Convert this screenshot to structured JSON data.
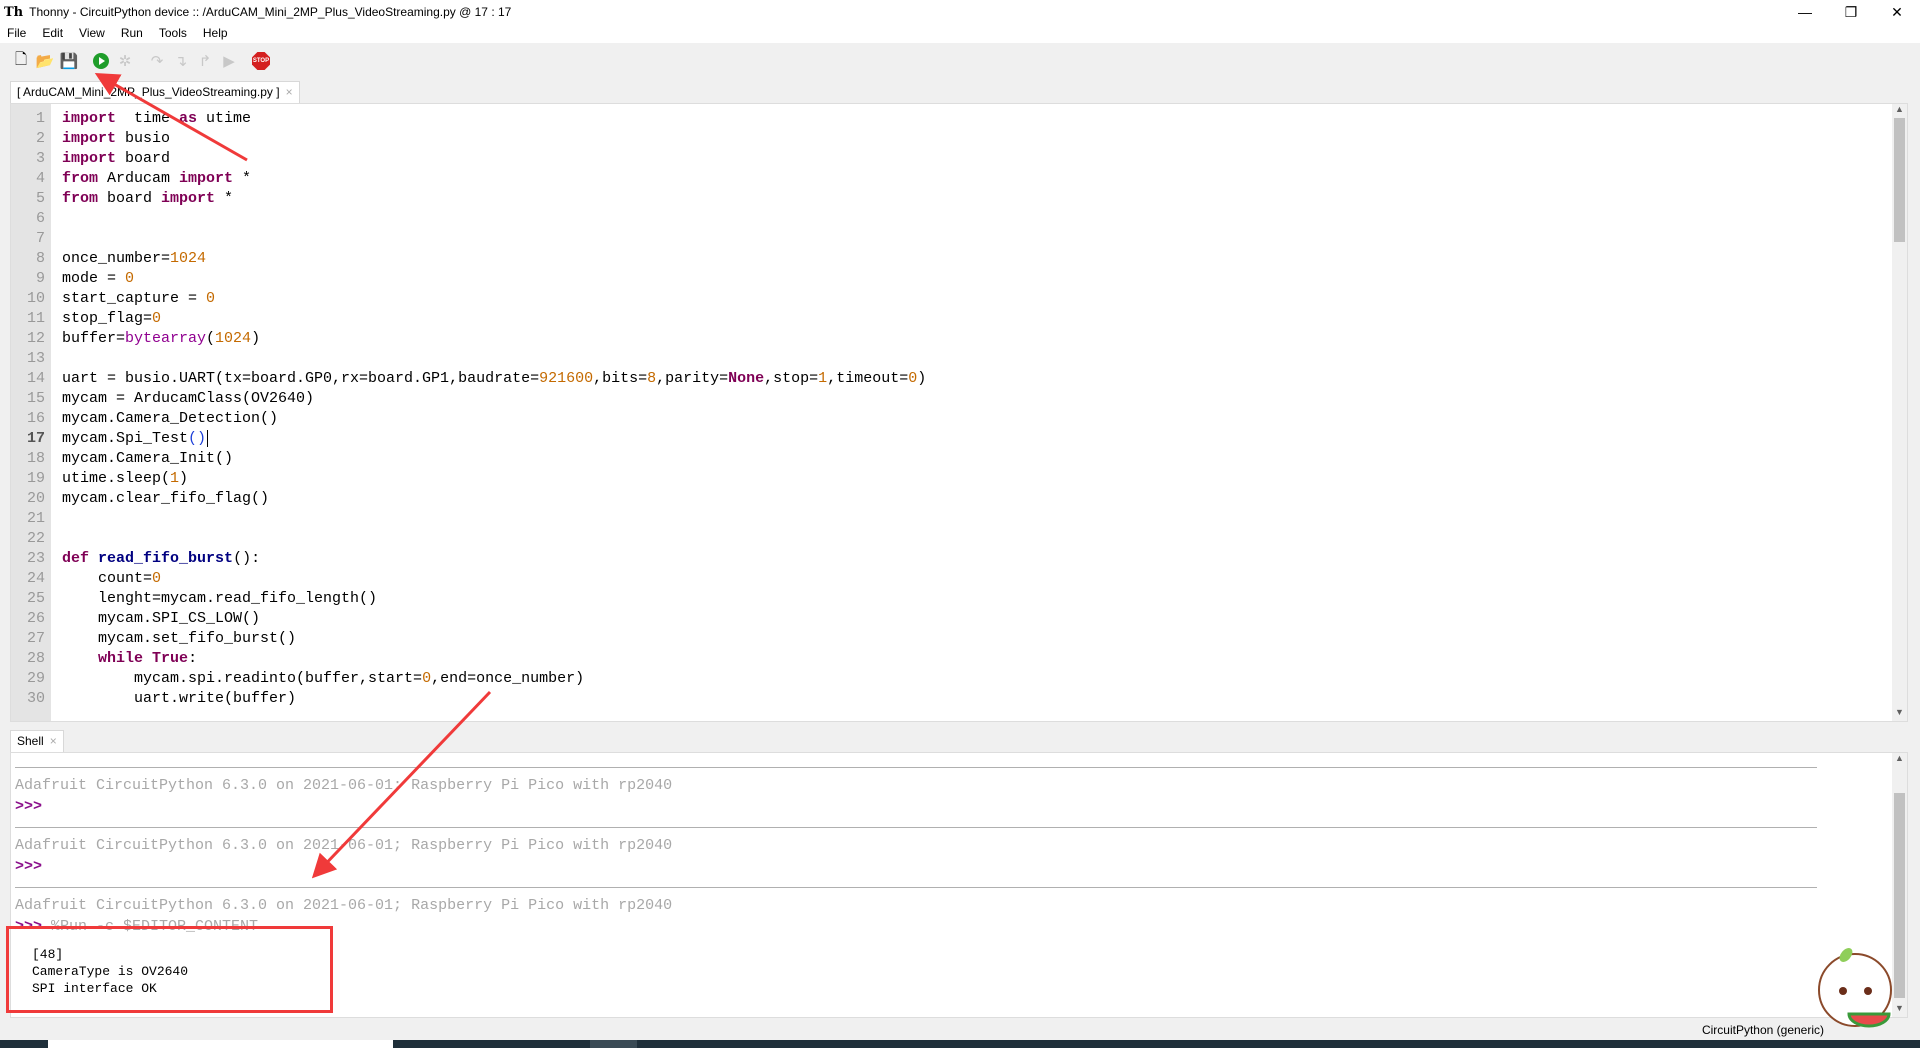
{
  "window": {
    "title": "Thonny  -  CircuitPython device :: /ArduCAM_Mini_2MP_Plus_VideoStreaming.py  @  17 : 17",
    "logo": "Th",
    "minimize": "—",
    "restore": "❐",
    "close": "✕"
  },
  "menu": [
    "File",
    "Edit",
    "View",
    "Run",
    "Tools",
    "Help"
  ],
  "toolbar": {
    "icons": [
      "new-file-icon",
      "open-file-icon",
      "save-icon",
      "run-icon",
      "debug-icon",
      "step-over-icon",
      "step-into-icon",
      "step-out-icon",
      "resume-icon",
      "stop-icon"
    ],
    "stop_label": "STOP"
  },
  "editor": {
    "tab_label": "[ ArduCAM_Mini_2MP_Plus_VideoStreaming.py ]",
    "tab_close": "×",
    "current_line": 17,
    "lines": [
      [
        [
          "kw",
          "import"
        ],
        [
          "",
          "  time "
        ],
        [
          "kw",
          "as"
        ],
        [
          "",
          " utime"
        ]
      ],
      [
        [
          "kw",
          "import"
        ],
        [
          "",
          " busio"
        ]
      ],
      [
        [
          "kw",
          "import"
        ],
        [
          "",
          " board"
        ]
      ],
      [
        [
          "kw",
          "from"
        ],
        [
          "",
          " Arducam "
        ],
        [
          "kw",
          "import"
        ],
        [
          "",
          " *"
        ]
      ],
      [
        [
          "kw",
          "from"
        ],
        [
          "",
          " board "
        ],
        [
          "kw",
          "import"
        ],
        [
          "",
          " *"
        ]
      ],
      [],
      [],
      [
        [
          "",
          "once_number="
        ],
        [
          "num",
          "1024"
        ]
      ],
      [
        [
          "",
          "mode = "
        ],
        [
          "num",
          "0"
        ]
      ],
      [
        [
          "",
          "start_capture = "
        ],
        [
          "num",
          "0"
        ]
      ],
      [
        [
          "",
          "stop_flag="
        ],
        [
          "num",
          "0"
        ]
      ],
      [
        [
          "",
          "buffer="
        ],
        [
          "bi",
          "bytearray"
        ],
        [
          "",
          "("
        ],
        [
          "num",
          "1024"
        ],
        [
          "",
          ")"
        ]
      ],
      [],
      [
        [
          "",
          "uart = busio.UART(tx=board.GP0,rx=board.GP1,baudrate="
        ],
        [
          "num",
          "921600"
        ],
        [
          "",
          ",bits="
        ],
        [
          "num",
          "8"
        ],
        [
          "",
          ",parity="
        ],
        [
          "kw",
          "None"
        ],
        [
          "",
          ",stop="
        ],
        [
          "num",
          "1"
        ],
        [
          "",
          ",timeout="
        ],
        [
          "num",
          "0"
        ],
        [
          "",
          ")"
        ]
      ],
      [
        [
          "",
          "mycam = ArducamClass(OV2640)"
        ]
      ],
      [
        [
          "",
          "mycam.Camera_Detection()"
        ]
      ],
      [
        [
          "",
          "mycam.Spi_Test"
        ],
        [
          "br",
          "()"
        ],
        [
          "caret",
          ""
        ]
      ],
      [
        [
          "",
          "mycam.Camera_Init()"
        ]
      ],
      [
        [
          "",
          "utime.sleep("
        ],
        [
          "num",
          "1"
        ],
        [
          "",
          ")"
        ]
      ],
      [
        [
          "",
          "mycam.clear_fifo_flag()"
        ]
      ],
      [],
      [],
      [
        [
          "kw",
          "def"
        ],
        [
          "",
          " "
        ],
        [
          "fn",
          "read_fifo_burst"
        ],
        [
          "",
          "():"
        ]
      ],
      [
        [
          "",
          "    count="
        ],
        [
          "num",
          "0"
        ]
      ],
      [
        [
          "",
          "    lenght=mycam.read_fifo_length()"
        ]
      ],
      [
        [
          "",
          "    mycam.SPI_CS_LOW()"
        ]
      ],
      [
        [
          "",
          "    mycam.set_fifo_burst()"
        ]
      ],
      [
        [
          "",
          "    "
        ],
        [
          "kw",
          "while"
        ],
        [
          "",
          " "
        ],
        [
          "kw",
          "True"
        ],
        [
          "",
          ":"
        ]
      ],
      [
        [
          "",
          "        mycam.spi.readinto(buffer,start="
        ],
        [
          "num",
          "0"
        ],
        [
          "",
          ",end=once_number)"
        ]
      ],
      [
        [
          "",
          "        uart.write(buffer)"
        ]
      ]
    ]
  },
  "shell": {
    "tab_label": "Shell",
    "tab_close": "×",
    "banner": "Adafruit CircuitPython 6.3.0 on 2021-06-01; Raspberry Pi Pico with rp2040",
    "prompt": ">>>",
    "command": " %Run -c $EDITOR_CONTENT",
    "output": [
      "[48]",
      "CameraType is OV2640",
      "SPI interface OK"
    ]
  },
  "status": {
    "interpreter": "CircuitPython (generic)"
  },
  "colors": {
    "keyword": "#7f0055",
    "function": "#000080",
    "number": "#c46a00",
    "annotation": "#f03a3a",
    "run": "#1f9d2a"
  }
}
